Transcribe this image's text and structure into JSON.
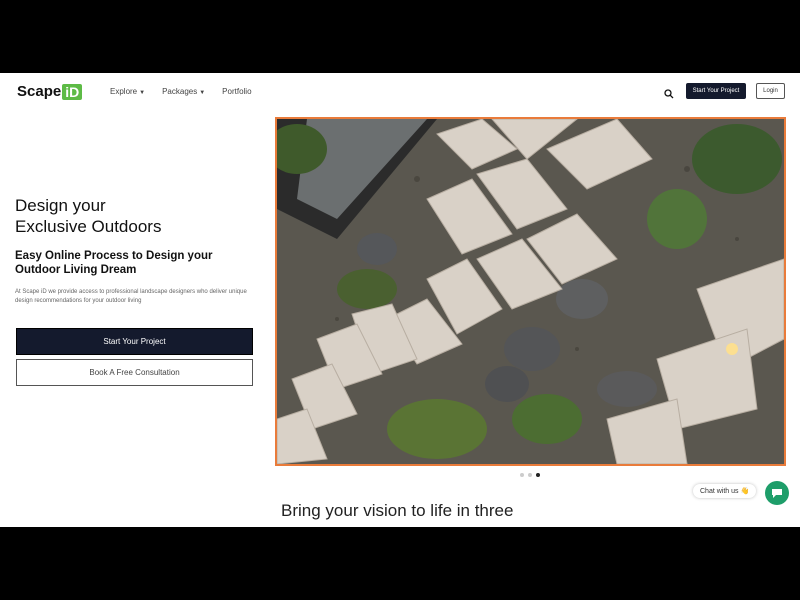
{
  "brand": {
    "name": "Scape",
    "badge": "iD",
    "accent": "#5dbb46"
  },
  "nav": {
    "items": [
      {
        "label": "Explore",
        "dropdown": true
      },
      {
        "label": "Packages",
        "dropdown": true
      },
      {
        "label": "Portfolio",
        "dropdown": false
      }
    ],
    "search_icon": "search-icon",
    "start_label": "Start Your Project",
    "login_label": "Login"
  },
  "hero": {
    "title_line1": "Design your",
    "title_line2": "Exclusive Outdoors",
    "subtitle_line1": "Easy Online Process to Design your",
    "subtitle_line2": "Outdoor Living Dream",
    "description": "At Scape iD we provide access to professional landscape designers who deliver unique design recommendations for your outdoor living",
    "primary_button": "Start Your Project",
    "secondary_button": "Book A Free Consultation",
    "image_border": "#e97b3a",
    "carousel_active_index": 2
  },
  "chat": {
    "label": "Chat with us 👋",
    "color": "#1e9e6a"
  },
  "section": {
    "heading": "Bring your vision to life in three"
  },
  "colors": {
    "dark": "#141a2d",
    "background": "#000000"
  }
}
